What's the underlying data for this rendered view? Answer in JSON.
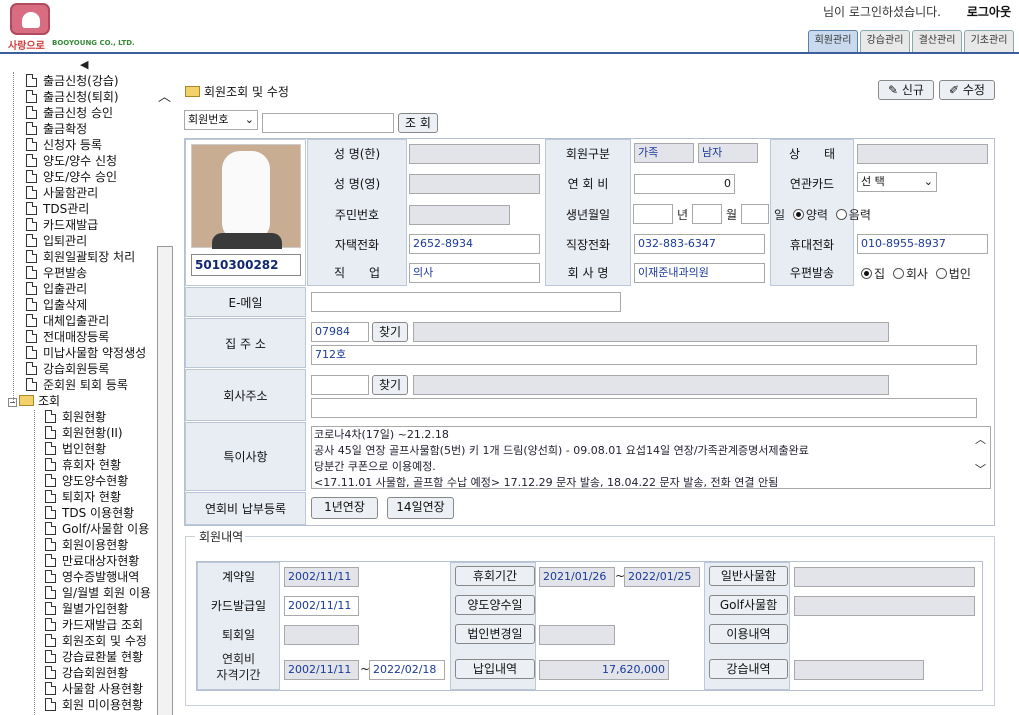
{
  "header": {
    "logo_text": "사랑으로",
    "logo_sub": "BOOYOUNG CO., LTD.",
    "login_msg": "님이 로그인하셨습니다.",
    "logout": "로그아웃",
    "tabs": [
      "회원관리",
      "강습관리",
      "결산관리",
      "기초관리"
    ]
  },
  "sidebar": {
    "collapse_arrow": "◀",
    "items_top": [
      "출금신청(강습)",
      "출금신청(퇴회)",
      "출금신청 승인",
      "출금확정",
      "신청자 등록",
      "양도/양수 신청",
      "양도/양수 승인",
      "사물함관리",
      "TDS관리",
      "카드재발급",
      "입퇴관리",
      "회원일괄퇴장 처리",
      "우편발송",
      "입출관리",
      "입출삭제",
      "대체입출관리",
      "전대매장등록",
      "미납사물함 약정생성",
      "강습회원등록",
      "준회원 퇴회 등록"
    ],
    "folder_label": "조회",
    "items_sub": [
      "회원현황",
      "회원현황(II)",
      "법인현황",
      "휴회자 현황",
      "양도양수현황",
      "퇴회자 현황",
      "TDS 이용현황",
      "Golf/사물함 이용",
      "회원이용현황",
      "만료대상자현황",
      "영수증발행내역",
      "일/월별 회원 이용",
      "월별가입현황",
      "카드재발급 조회",
      "회원조회 및 수정",
      "강습료환불 현황",
      "강습회원현황",
      "사물함 사용현황",
      "회원 미이용현황"
    ]
  },
  "main": {
    "title": "회원조회 및 수정",
    "btn_new": "신규",
    "btn_edit": "수정",
    "search_select": "회원번호",
    "search_btn": "조 회",
    "member_no": "5010300282",
    "labels": {
      "name_kr": "성 명(한)",
      "member_type": "회원구분",
      "status": "상　　태",
      "name_en": "성 명(영)",
      "annual_fee": "연 회 비",
      "related_card": "연관카드",
      "resident_no": "주민번호",
      "birth": "생년월일",
      "home_phone": "자택전화",
      "work_phone": "직장전화",
      "mobile": "휴대전화",
      "job": "직　　업",
      "company_name": "회 사 명",
      "mail": "우편발송",
      "email": "E-메일",
      "home_addr": "집 주 소",
      "company_addr": "회사주소",
      "remarks": "특이사항",
      "fee_reg": "연회비 납부등록"
    },
    "values": {
      "member_type_1": "가족",
      "member_type_2": "남자",
      "annual_fee": "0",
      "related_card": "선 택",
      "year_unit": "년",
      "month_unit": "월",
      "day_unit": "일",
      "solar": "양력",
      "lunar": "음력",
      "home_phone": "2652-8934",
      "work_phone": "032-883-6347",
      "mobile": "010-8955-8937",
      "job": "의사",
      "company_name": "이재준내과의원",
      "mail_home": "집",
      "mail_company": "회사",
      "mail_corp": "법인",
      "home_zip": "07984",
      "home_addr2": "712호",
      "find_btn": "찾기"
    },
    "remarks": [
      "코로나4차(17일) ~21.2.18",
      "공사 45일 연장 골프사물함(5번) 키 1개 드림(양선희) - 09.08.01 요섭14일 연장/가족관계증명서제출완료",
      "당분간 쿠폰으로 이용예정.",
      "<17.11.01 사물함, 골프함 수납 예정> 17.12.29 문자 발송, 18.04.22 문자 발송, 전화 연결 안됨"
    ],
    "fee_btns": [
      "1년연장",
      "14일연장"
    ]
  },
  "history": {
    "title": "회원내역",
    "labels": {
      "contract": "계약일",
      "leave_period": "휴회기간",
      "general_locker": "일반사물함",
      "card_issue": "카드발급일",
      "transfer": "양도양수일",
      "golf_locker": "Golf사물함",
      "withdraw": "퇴회일",
      "corp_change": "법인변경일",
      "usage": "이용내역",
      "qual_period_1": "연회비",
      "qual_period_2": "자격기간",
      "payment": "납입내역",
      "lesson": "강습내역"
    },
    "values": {
      "contract": "2002/11/11",
      "leave_from": "2021/01/26",
      "tilde": "~",
      "leave_to": "2022/01/25",
      "card_issue": "2002/11/11",
      "qual_from": "2002/11/11",
      "qual_to": "2022/02/18",
      "payment": "17,620,000"
    }
  }
}
